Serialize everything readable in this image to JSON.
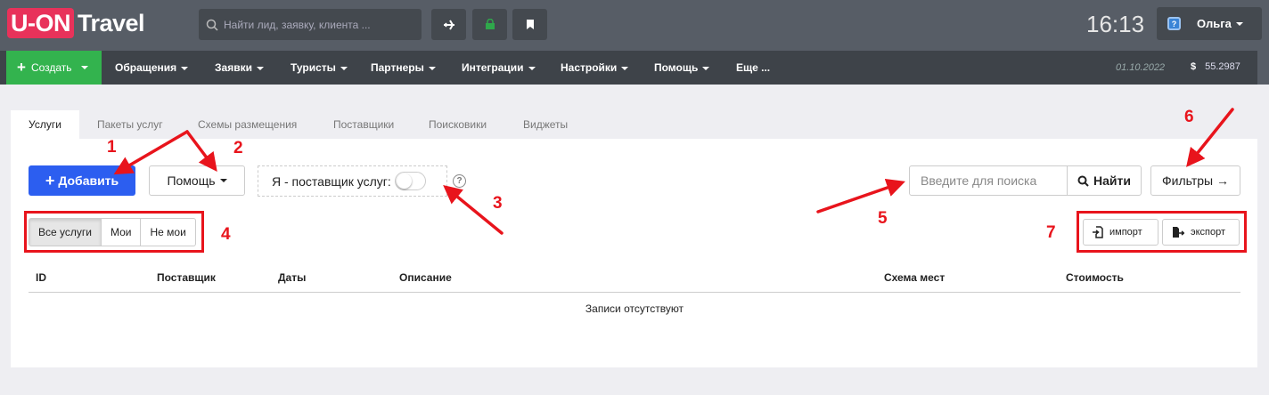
{
  "header": {
    "logo_brand": "U-ON",
    "logo_text": "Travel",
    "search_placeholder": "Найти лид, заявку, клиента ...",
    "clock": "16:13",
    "user_name": "Ольга"
  },
  "menu": {
    "create": "Создать",
    "items": [
      "Обращения",
      "Заявки",
      "Туристы",
      "Партнеры",
      "Интеграции",
      "Настройки",
      "Помощь",
      "Еще ..."
    ],
    "date": "01.10.2022",
    "currency_symbol": "$",
    "rate": "55.2987"
  },
  "tabs": [
    "Услуги",
    "Пакеты услуг",
    "Схемы размещения",
    "Поставщики",
    "Поисковики",
    "Виджеты"
  ],
  "toolbar": {
    "add": "Добавить",
    "help": "Помощь",
    "supplier_toggle_label": "Я - поставщик услуг:",
    "supplier_toggle_on": false,
    "search_placeholder": "Введите для поиска",
    "find": "Найти",
    "filters": "Фильтры →"
  },
  "filter_group": [
    "Все услуги",
    "Мои",
    "Не мои"
  ],
  "io": {
    "import": "импорт",
    "export": "экспорт"
  },
  "table": {
    "columns": [
      "ID",
      "Поставщик",
      "Даты",
      "Описание",
      "Схема мест",
      "Стоимость"
    ],
    "empty_text": "Записи отсутствуют"
  },
  "annotations": [
    "1",
    "2",
    "3",
    "4",
    "5",
    "6",
    "7"
  ],
  "colors": {
    "accent_blue": "#2c5ef0",
    "create_green": "#33b34e",
    "annotation_red": "#e8141c",
    "logo_pink": "#e8325a"
  }
}
